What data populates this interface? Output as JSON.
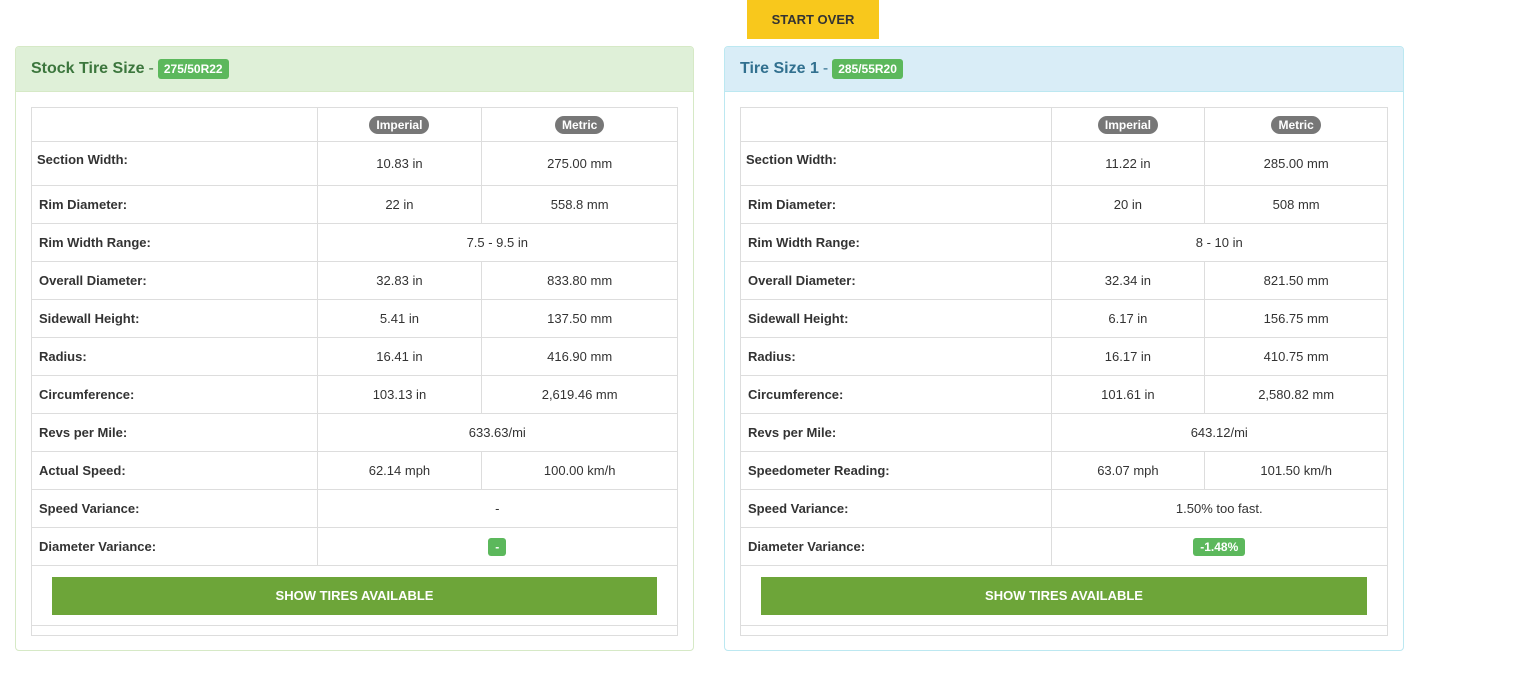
{
  "start_over": "START OVER",
  "stock": {
    "title": "Stock Tire Size",
    "separator": "-",
    "size": "275/50R22",
    "col_imperial": "Imperial",
    "col_metric": "Metric",
    "rows": {
      "section_width": {
        "label": "Section Width:",
        "imperial": "10.83 in",
        "metric": "275.00 mm"
      },
      "rim_diameter": {
        "label": "Rim Diameter:",
        "imperial": "22 in",
        "metric": "558.8 mm"
      },
      "rim_width_range": {
        "label": "Rim Width Range:",
        "value": "7.5 - 9.5 in"
      },
      "overall_diameter": {
        "label": "Overall Diameter:",
        "imperial": "32.83 in",
        "metric": "833.80 mm"
      },
      "sidewall_height": {
        "label": "Sidewall Height:",
        "imperial": "5.41 in",
        "metric": "137.50 mm"
      },
      "radius": {
        "label": "Radius:",
        "imperial": "16.41 in",
        "metric": "416.90 mm"
      },
      "circumference": {
        "label": "Circumference:",
        "imperial": "103.13 in",
        "metric": "2,619.46 mm"
      },
      "revs_per_mile": {
        "label": "Revs per Mile:",
        "value": "633.63/mi"
      },
      "speed": {
        "label": "Actual Speed:",
        "imperial": "62.14 mph",
        "metric": "100.00 km/h"
      },
      "speed_variance": {
        "label": "Speed Variance:",
        "value": "-"
      },
      "diameter_variance": {
        "label": "Diameter Variance:",
        "value": "-"
      }
    },
    "button": "SHOW TIRES AVAILABLE"
  },
  "size1": {
    "title": "Tire Size 1",
    "separator": "-",
    "size": "285/55R20",
    "col_imperial": "Imperial",
    "col_metric": "Metric",
    "rows": {
      "section_width": {
        "label": "Section Width:",
        "imperial": "11.22 in",
        "metric": "285.00 mm"
      },
      "rim_diameter": {
        "label": "Rim Diameter:",
        "imperial": "20 in",
        "metric": "508 mm"
      },
      "rim_width_range": {
        "label": "Rim Width Range:",
        "value": "8 - 10 in"
      },
      "overall_diameter": {
        "label": "Overall Diameter:",
        "imperial": "32.34 in",
        "metric": "821.50 mm"
      },
      "sidewall_height": {
        "label": "Sidewall Height:",
        "imperial": "6.17 in",
        "metric": "156.75 mm"
      },
      "radius": {
        "label": "Radius:",
        "imperial": "16.17 in",
        "metric": "410.75 mm"
      },
      "circumference": {
        "label": "Circumference:",
        "imperial": "101.61 in",
        "metric": "2,580.82 mm"
      },
      "revs_per_mile": {
        "label": "Revs per Mile:",
        "value": "643.12/mi"
      },
      "speed": {
        "label": "Speedometer Reading:",
        "imperial": "63.07 mph",
        "metric": "101.50 km/h"
      },
      "speed_variance": {
        "label": "Speed Variance:",
        "value": "1.50% too fast."
      },
      "diameter_variance": {
        "label": "Diameter Variance:",
        "value": "-1.48%"
      }
    },
    "button": "SHOW TIRES AVAILABLE"
  }
}
